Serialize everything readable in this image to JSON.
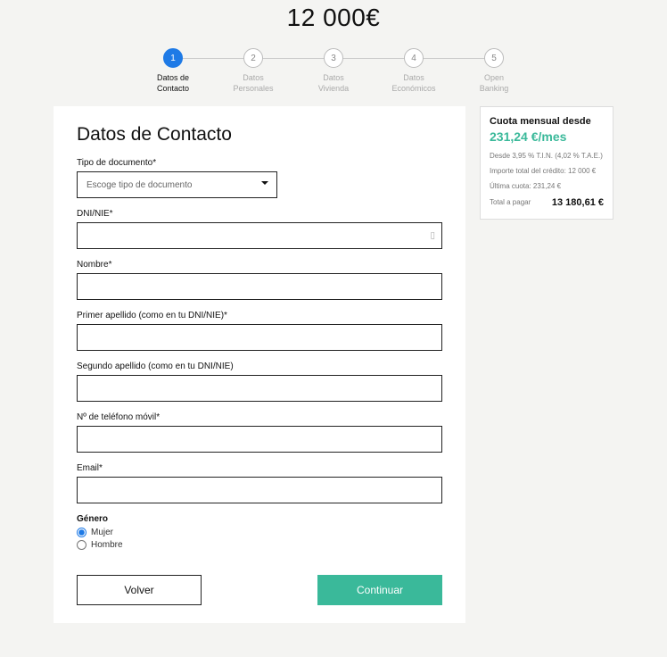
{
  "amount": "12 000€",
  "steps": [
    {
      "num": "1",
      "label": "Datos de\nContacto",
      "active": true
    },
    {
      "num": "2",
      "label": "Datos\nPersonales",
      "active": false
    },
    {
      "num": "3",
      "label": "Datos\nVivienda",
      "active": false
    },
    {
      "num": "4",
      "label": "Datos\nEconómicos",
      "active": false
    },
    {
      "num": "5",
      "label": "Open\nBanking",
      "active": false
    }
  ],
  "form": {
    "title": "Datos de Contacto",
    "doc_type_label": "Tipo de documento*",
    "doc_type_placeholder": "Escoge tipo de documento",
    "dni_label": "DNI/NIE*",
    "nombre_label": "Nombre*",
    "primer_apellido_label": "Primer apellido (como en tu DNI/NIE)*",
    "segundo_apellido_label": "Segundo apellido (como en tu DNI/NIE)",
    "telefono_label": "Nº de teléfono móvil*",
    "email_label": "Email*",
    "genero_label": "Género",
    "genero_mujer": "Mujer",
    "genero_hombre": "Hombre"
  },
  "buttons": {
    "volver": "Volver",
    "continuar": "Continuar"
  },
  "summary": {
    "title": "Cuota mensual desde",
    "price": "231,24 €/mes",
    "tin_tae": "Desde 3,95 % T.I.N. (4,02 % T.A.E.)",
    "importe": "Importe total del crédito: 12 000 €",
    "ultima": "Última cuota: 231,24 €",
    "total_label": "Total a pagar",
    "total_val": "13 180,61 €"
  }
}
